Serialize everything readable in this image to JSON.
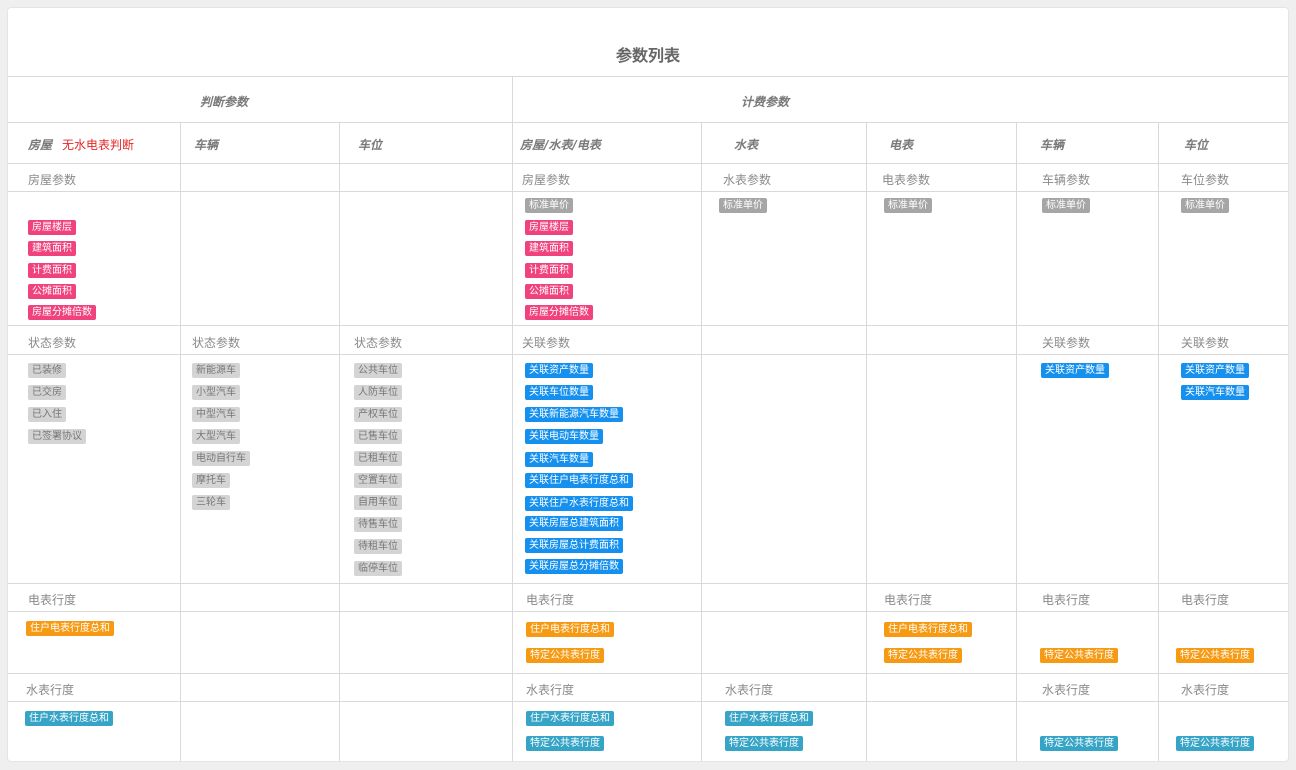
{
  "title": "参数列表",
  "groups": {
    "judge": "判断参数",
    "billing": "计费参数"
  },
  "columns": {
    "house": "房屋",
    "house_note": "无水电表判断",
    "vehicle": "车辆",
    "parking": "车位",
    "billing_house": "房屋/水表/电表",
    "billing_water": "水表",
    "billing_elec": "电表",
    "billing_vehicle": "车辆",
    "billing_parking": "车位"
  },
  "sections": {
    "house_params": "房屋参数",
    "water_params": "水表参数",
    "elec_params": "电表参数",
    "vehicle_params": "车辆参数",
    "parking_params": "车位参数",
    "status_params": "状态参数",
    "related_params": "关联参数",
    "elec_reading": "电表行度",
    "water_reading": "水表行度"
  },
  "tags": {
    "std_price": "标准单价",
    "house_fields": [
      "房屋楼层",
      "建筑面积",
      "计费面积",
      "公摊面积",
      "房屋分摊倍数"
    ],
    "house_status": [
      "已装修",
      "已交房",
      "已入住",
      "已签署协议"
    ],
    "vehicle_status": [
      "新能源车",
      "小型汽车",
      "中型汽车",
      "大型汽车",
      "电动自行车",
      "摩托车",
      "三轮车"
    ],
    "parking_status": [
      "公共车位",
      "人防车位",
      "产权车位",
      "已售车位",
      "已租车位",
      "空置车位",
      "自用车位",
      "待售车位",
      "待租车位",
      "临停车位"
    ],
    "related_house": [
      "关联资产数量",
      "关联车位数量",
      "关联新能源汽车数量",
      "关联电动车数量",
      "关联汽车数量",
      "关联住户电表行度总和",
      "关联住户水表行度总和",
      "关联房屋总建筑面积",
      "关联房屋总计费面积",
      "关联房屋总分摊倍数"
    ],
    "related_vehicle": [
      "关联资产数量"
    ],
    "related_parking": [
      "关联资产数量",
      "关联汽车数量"
    ],
    "elec_total": "住户电表行度总和",
    "public_meter": "特定公共表行度",
    "water_total": "住户水表行度总和"
  },
  "colors": {
    "gray": "#a6a6a6",
    "pink": "#f0427d",
    "blue": "#1590ee",
    "orange": "#f79a13",
    "teal": "#36a4c6"
  }
}
